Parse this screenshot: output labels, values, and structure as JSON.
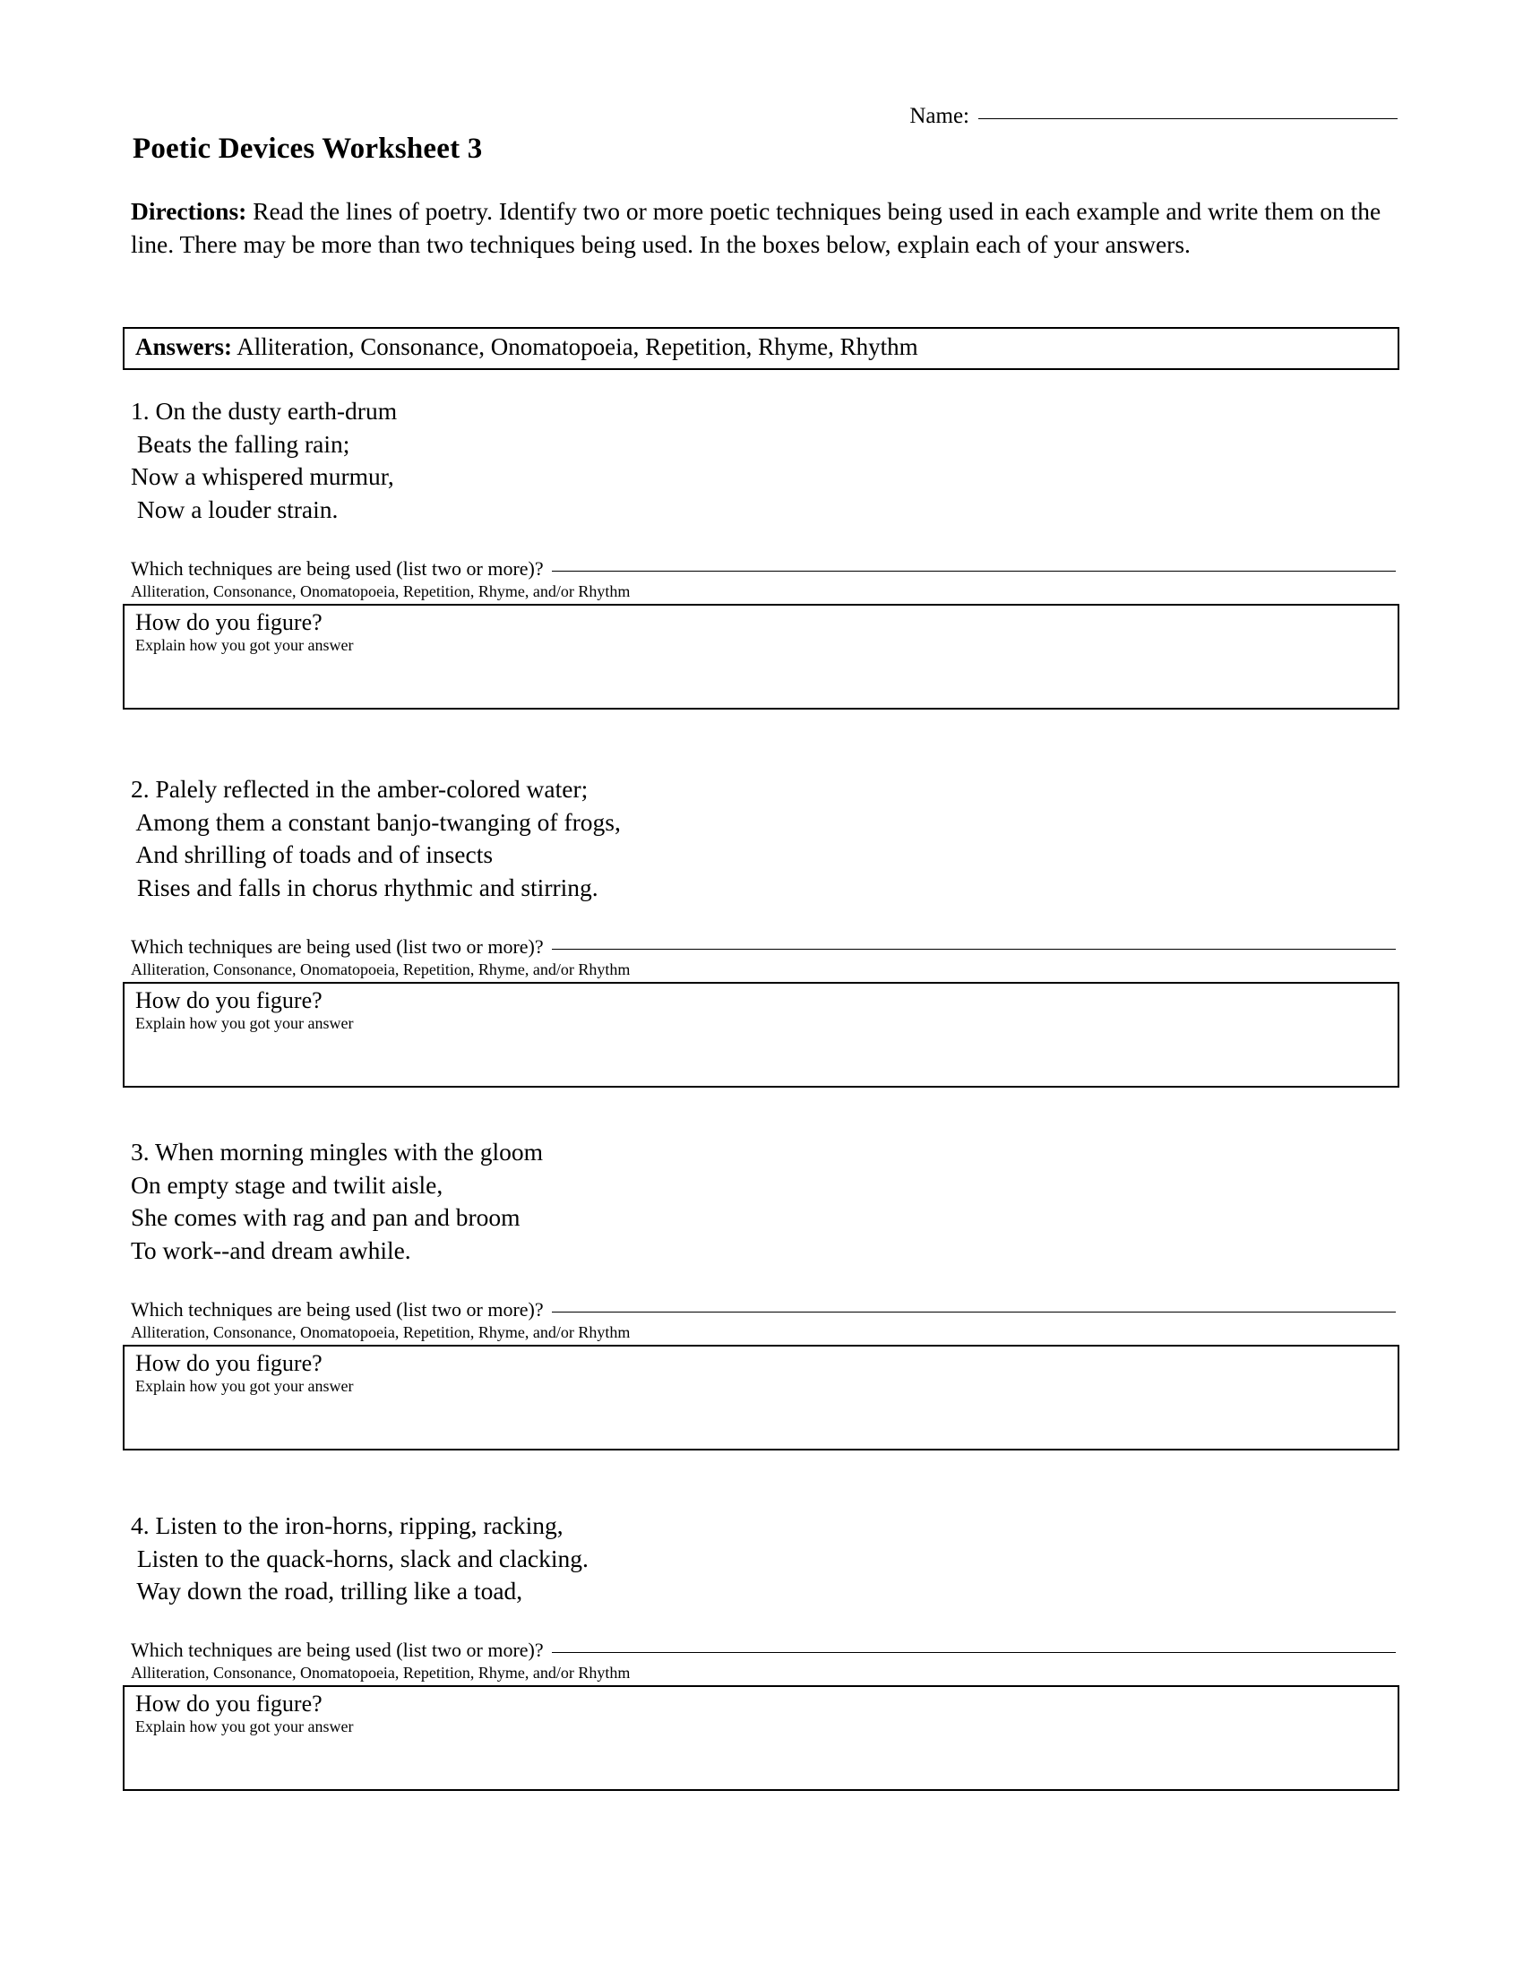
{
  "header": {
    "name_label": "Name:",
    "name_value": "",
    "title": "Poetic Devices Worksheet 3"
  },
  "directions": {
    "label": "Directions:",
    "text": "Read the lines of poetry. Identify two or more poetic techniques being used in each example and write them on the line. There may be more than two techniques being used. In the boxes below, explain each of your answers."
  },
  "answer_bank": {
    "label": "Answers:",
    "options_text": "Alliteration, Consonance, Onomatopoeia, Repetition, Rhyme, Rhythm",
    "options": [
      "Alliteration",
      "Consonance",
      "Onomatopoeia",
      "Repetition",
      "Rhyme",
      "Rhythm"
    ]
  },
  "common": {
    "prompt": "Which techniques are being used (list two or more)?",
    "hint": "Alliteration, Consonance, Onomatopoeia, Repetition, Rhyme, and/or Rhythm",
    "figure_title": "How do you figure?",
    "figure_sub": "Explain how you got your answer",
    "answer_value": "",
    "explanation_value": ""
  },
  "questions": [
    {
      "number": "1.",
      "lines": [
        "1. On the dusty earth-drum",
        " Beats the falling rain;",
        "Now a whispered murmur,",
        " Now a louder strain."
      ]
    },
    {
      "number": "2.",
      "lines": [
        "2. Palely reflected in the amber-colored water;",
        " Among them a constant banjo-twanging of frogs,",
        " And shrilling of toads and of insects",
        " Rises and falls in chorus rhythmic and stirring."
      ]
    },
    {
      "number": "3.",
      "lines": [
        "3. When morning mingles with the gloom",
        "On empty stage and twilit aisle,",
        "She comes with rag and pan and broom",
        "To work--and dream awhile."
      ]
    },
    {
      "number": "4.",
      "lines": [
        "4. Listen to the iron-horns, ripping, racking,",
        " Listen to the quack-horns, slack and clacking.",
        " Way down the road, trilling like a toad,"
      ]
    }
  ],
  "layout": {
    "question_tops": [
      441,
      863,
      1268,
      1685
    ]
  }
}
